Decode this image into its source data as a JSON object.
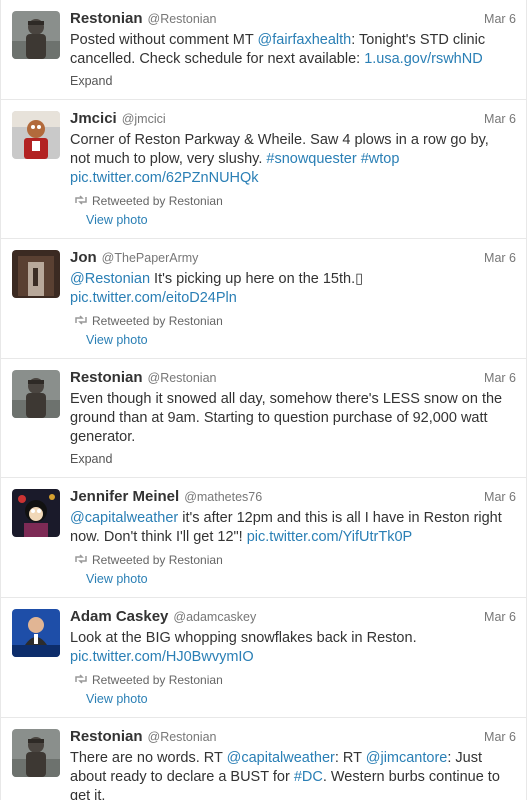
{
  "tweets": [
    {
      "name": "Restonian",
      "handle": "@Restonian",
      "time": "Mar 6",
      "avatar": "statue-avatar",
      "text": [
        {
          "t": "Posted without comment MT "
        },
        {
          "t": "@fairfaxhealth",
          "link": true
        },
        {
          "t": ": Tonight's STD clinic cancelled. Check schedule for next available: "
        },
        {
          "t": "1.usa.gov/rswhND",
          "link": true
        }
      ],
      "retweeted_by": "",
      "action": "Expand"
    },
    {
      "name": "Jmcici",
      "handle": "@jmcici",
      "time": "Mar 6",
      "avatar": "mascot-avatar",
      "text": [
        {
          "t": "Corner of Reston Parkway & Wheile. Saw 4 plows in a row go by, not much to plow, very slushy. "
        },
        {
          "t": "#snowquester",
          "link": true
        },
        {
          "t": " "
        },
        {
          "t": "#wtop",
          "link": true
        },
        {
          "t": " "
        },
        {
          "t": "pic.twitter.com/62PZnNUHQk",
          "link": true
        }
      ],
      "retweeted_by": "Retweeted by Restonian",
      "action": "View photo"
    },
    {
      "name": "Jon",
      "handle": "@ThePaperArmy",
      "time": "Mar 6",
      "avatar": "doorway-avatar",
      "text": [
        {
          "t": "@Restonian",
          "link": true
        },
        {
          "t": " It's picking up here on the 15th.▯ "
        },
        {
          "t": "pic.twitter.com/eitoD24Pln",
          "link": true
        }
      ],
      "retweeted_by": "Retweeted by Restonian",
      "action": "View photo"
    },
    {
      "name": "Restonian",
      "handle": "@Restonian",
      "time": "Mar 6",
      "avatar": "statue-avatar",
      "text": [
        {
          "t": "Even though it snowed all day, somehow there's LESS snow on the ground than at 9am. Starting to question purchase of 92,000 watt generator."
        }
      ],
      "retweeted_by": "",
      "action": "Expand"
    },
    {
      "name": "Jennifer Meinel",
      "handle": "@mathetes76",
      "time": "Mar 6",
      "avatar": "cartoon-avatar",
      "text": [
        {
          "t": "@capitalweather",
          "link": true
        },
        {
          "t": " it's after 12pm and this is all I have in Reston right now. Don't think I'll get 12\"! "
        },
        {
          "t": "pic.twitter.com/YifUtrTk0P",
          "link": true
        }
      ],
      "retweeted_by": "Retweeted by Restonian",
      "action": "View photo"
    },
    {
      "name": "Adam Caskey",
      "handle": "@adamcaskey",
      "time": "Mar 6",
      "avatar": "news-avatar",
      "text": [
        {
          "t": "Look at the BIG whopping snowflakes back in Reston. "
        },
        {
          "t": "pic.twitter.com/HJ0BwvymIO",
          "link": true
        }
      ],
      "retweeted_by": "Retweeted by Restonian",
      "action": "View photo"
    },
    {
      "name": "Restonian",
      "handle": "@Restonian",
      "time": "Mar 6",
      "avatar": "statue-avatar",
      "text": [
        {
          "t": "There are no words. RT "
        },
        {
          "t": "@capitalweather",
          "link": true
        },
        {
          "t": ": RT "
        },
        {
          "t": "@jimcantore",
          "link": true
        },
        {
          "t": ": Just about ready to declare a BUST for "
        },
        {
          "t": "#DC",
          "link": true
        },
        {
          "t": ". Western burbs continue to get it."
        }
      ],
      "retweeted_by": "",
      "action": "Expand"
    }
  ]
}
